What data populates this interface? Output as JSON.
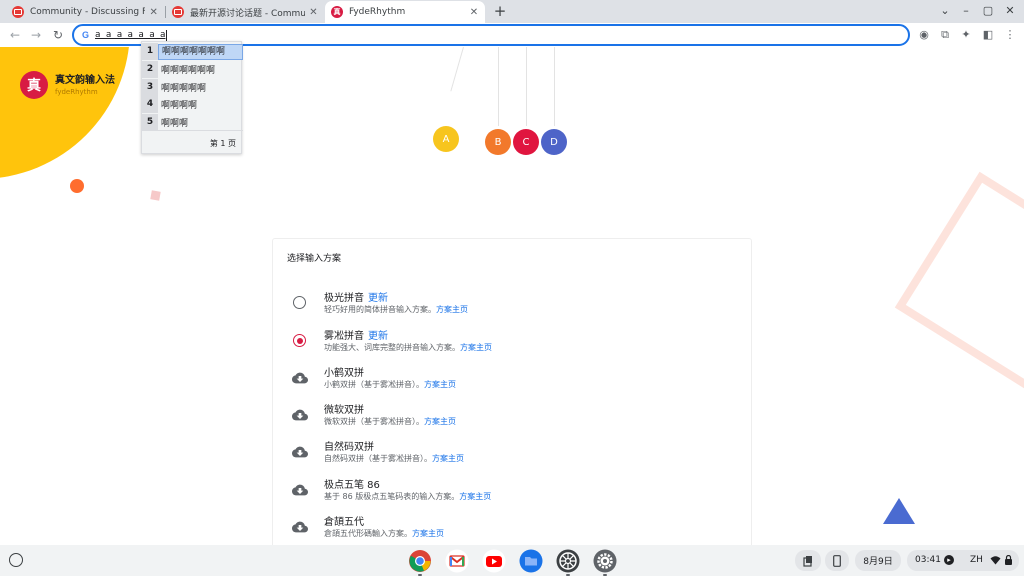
{
  "tabs": [
    {
      "title": "Community - Discussing Fyde",
      "active": false
    },
    {
      "title": "最新开源讨论话题 - Communit",
      "active": false
    },
    {
      "title": "FydeRhythm",
      "active": true
    }
  ],
  "tab_icon_fr": "真",
  "new_tab": "+",
  "strip_controls": {
    "dropdown": "⌄",
    "minimize": "–",
    "maximize": "▢",
    "close": "✕"
  },
  "nav": {
    "back": "←",
    "forward": "→",
    "reload": "↻"
  },
  "omnibox": {
    "google_glyph": "G",
    "text": "a_a_a_a_a_a_a"
  },
  "toolbar_icons": {
    "record": "◉",
    "cast": "⧉",
    "extensions": "✦",
    "sidepanel": "◧",
    "menu": "⋮"
  },
  "brand": {
    "logo": "真",
    "name": "真文韵输入法",
    "sub": "fydeRhythm"
  },
  "balls": [
    {
      "label": "A",
      "color": "#f7c51e"
    },
    {
      "label": "B",
      "color": "#f2792b"
    },
    {
      "label": "C",
      "color": "#e0153f"
    },
    {
      "label": "D",
      "color": "#4e64c8"
    }
  ],
  "card": {
    "title": "选择输入方案",
    "schemes": [
      {
        "name": "极光拼音",
        "update": "更新",
        "desc": "轻巧好用的简体拼音输入方案。",
        "link": "方案主页",
        "state": "radio-off"
      },
      {
        "name": "雾凇拼音",
        "update": "更新",
        "desc": "功能强大、词库完整的拼音输入方案。",
        "link": "方案主页",
        "state": "radio-on"
      },
      {
        "name": "小鹤双拼",
        "desc": "小鹤双拼（基于雾凇拼音）。",
        "link": "方案主页",
        "state": "download"
      },
      {
        "name": "微软双拼",
        "desc": "微软双拼（基于雾凇拼音）。",
        "link": "方案主页",
        "state": "download"
      },
      {
        "name": "自然码双拼",
        "desc": "自然码双拼（基于雾凇拼音）。",
        "link": "方案主页",
        "state": "download"
      },
      {
        "name": "极点五笔 86",
        "desc": "基于 86 版极点五笔码表的输入方案。",
        "link": "方案主页",
        "state": "download"
      },
      {
        "name": "倉頡五代",
        "desc": "倉頡五代形碼輸入方案。",
        "link": "方案主页",
        "state": "download"
      }
    ]
  },
  "ime": {
    "candidates": [
      {
        "num": "1",
        "text": "啊啊啊啊啊啊啊"
      },
      {
        "num": "2",
        "text": "啊啊啊啊啊啊"
      },
      {
        "num": "3",
        "text": "啊啊啊啊啊"
      },
      {
        "num": "4",
        "text": "啊啊啊啊"
      },
      {
        "num": "5",
        "text": "啊啊啊"
      }
    ],
    "page": "第 1 页"
  },
  "shelf": {
    "apps": [
      "chrome-icon",
      "gmail-icon",
      "youtube-icon",
      "files-icon",
      "web-store-icon",
      "settings-icon"
    ],
    "date": "8月9日",
    "time": "03:41",
    "ime_lang": "ZH"
  }
}
